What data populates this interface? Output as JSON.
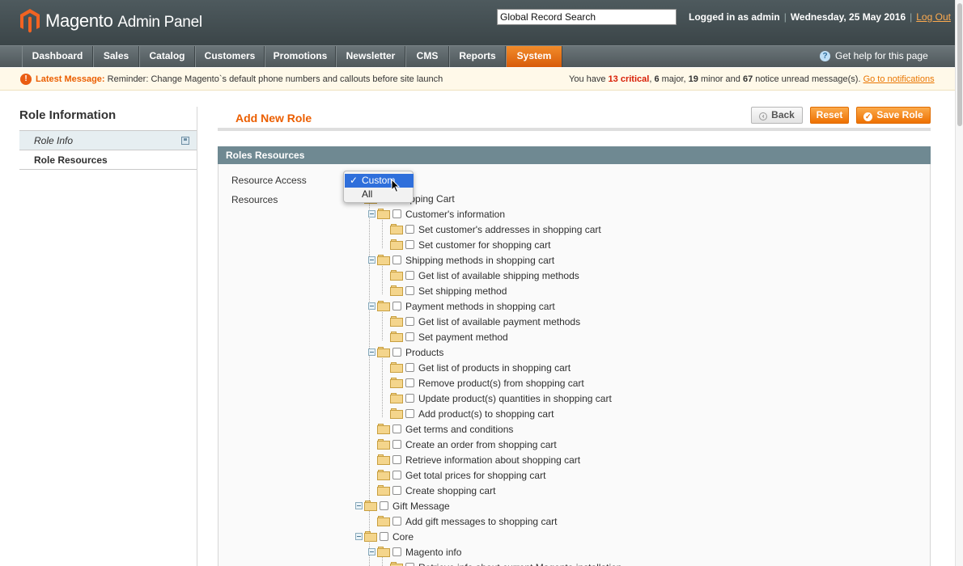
{
  "header": {
    "brand": "Magento",
    "brand_suffix": "Admin Panel",
    "search_value": "Global Record Search",
    "logged_in": "Logged in as admin",
    "date": "Wednesday, 25 May 2016",
    "logout": "Log Out"
  },
  "nav": {
    "items": [
      "Dashboard",
      "Sales",
      "Catalog",
      "Customers",
      "Promotions",
      "Newsletter",
      "CMS",
      "Reports",
      "System"
    ],
    "active": "System",
    "help": "Get help for this page"
  },
  "message": {
    "label": "Latest Message:",
    "text": "Reminder: Change Magento`s default phone numbers and callouts before site launch",
    "prefix": "You have",
    "critical": "13 critical",
    "major_n": "6",
    "major": "major,",
    "minor_n": "19",
    "minor": "minor and",
    "notice_n": "67",
    "notice": "notice unread message(s).",
    "link": "Go to notifications"
  },
  "sidebar": {
    "title": "Role Information",
    "tabs": [
      "Role Info",
      "Role Resources"
    ]
  },
  "page": {
    "title": "Add New Role",
    "back": "Back",
    "reset": "Reset",
    "save": "Save Role"
  },
  "fieldset": {
    "title": "Roles Resources",
    "resource_access_label": "Resource Access",
    "resources_label": "Resources"
  },
  "dropdown": {
    "options": [
      "Custom",
      "All"
    ],
    "selected": "Custom",
    "check": "✓"
  },
  "tree": [
    {
      "label": "Shopping Cart",
      "level": 0,
      "toggle": true,
      "partial": "pping Cart"
    },
    {
      "label": "Customer's information",
      "level": 1,
      "toggle": true
    },
    {
      "label": "Set customer's addresses in shopping cart",
      "level": 2,
      "toggle": false
    },
    {
      "label": "Set customer for shopping cart",
      "level": 2,
      "toggle": false
    },
    {
      "label": "Shipping methods in shopping cart",
      "level": 1,
      "toggle": true
    },
    {
      "label": "Get list of available shipping methods",
      "level": 2,
      "toggle": false
    },
    {
      "label": "Set shipping method",
      "level": 2,
      "toggle": false
    },
    {
      "label": "Payment methods in shopping cart",
      "level": 1,
      "toggle": true
    },
    {
      "label": "Get list of available payment methods",
      "level": 2,
      "toggle": false
    },
    {
      "label": "Set payment method",
      "level": 2,
      "toggle": false
    },
    {
      "label": "Products",
      "level": 1,
      "toggle": true
    },
    {
      "label": "Get list of products in shopping cart",
      "level": 2,
      "toggle": false
    },
    {
      "label": "Remove product(s) from shopping cart",
      "level": 2,
      "toggle": false
    },
    {
      "label": "Update product(s) quantities in shopping cart",
      "level": 2,
      "toggle": false
    },
    {
      "label": "Add product(s) to shopping cart",
      "level": 2,
      "toggle": false
    },
    {
      "label": "Get terms and conditions",
      "level": 1,
      "toggle": false
    },
    {
      "label": "Create an order from shopping cart",
      "level": 1,
      "toggle": false
    },
    {
      "label": "Retrieve information about shopping cart",
      "level": 1,
      "toggle": false
    },
    {
      "label": "Get total prices for shopping cart",
      "level": 1,
      "toggle": false
    },
    {
      "label": "Create shopping cart",
      "level": 1,
      "toggle": false
    },
    {
      "label": "Gift Message",
      "level": 0,
      "toggle": true
    },
    {
      "label": "Add gift messages to shopping cart",
      "level": 1,
      "toggle": false
    },
    {
      "label": "Core",
      "level": 0,
      "toggle": true
    },
    {
      "label": "Magento info",
      "level": 1,
      "toggle": true
    },
    {
      "label": "Retrieve info about current Magento installation",
      "level": 2,
      "toggle": false
    }
  ],
  "colors": {
    "accent": "#eb5e00",
    "header": "#3b4548",
    "fieldset_head": "#6f8992",
    "dropdown_selected": "#2f6fdb"
  },
  "icons": [
    "magento-logo-icon",
    "help-icon",
    "warning-icon",
    "save-state-icon",
    "back-arrow-icon",
    "checkmark-icon",
    "folder-icon",
    "collapse-icon",
    "cursor-icon"
  ]
}
